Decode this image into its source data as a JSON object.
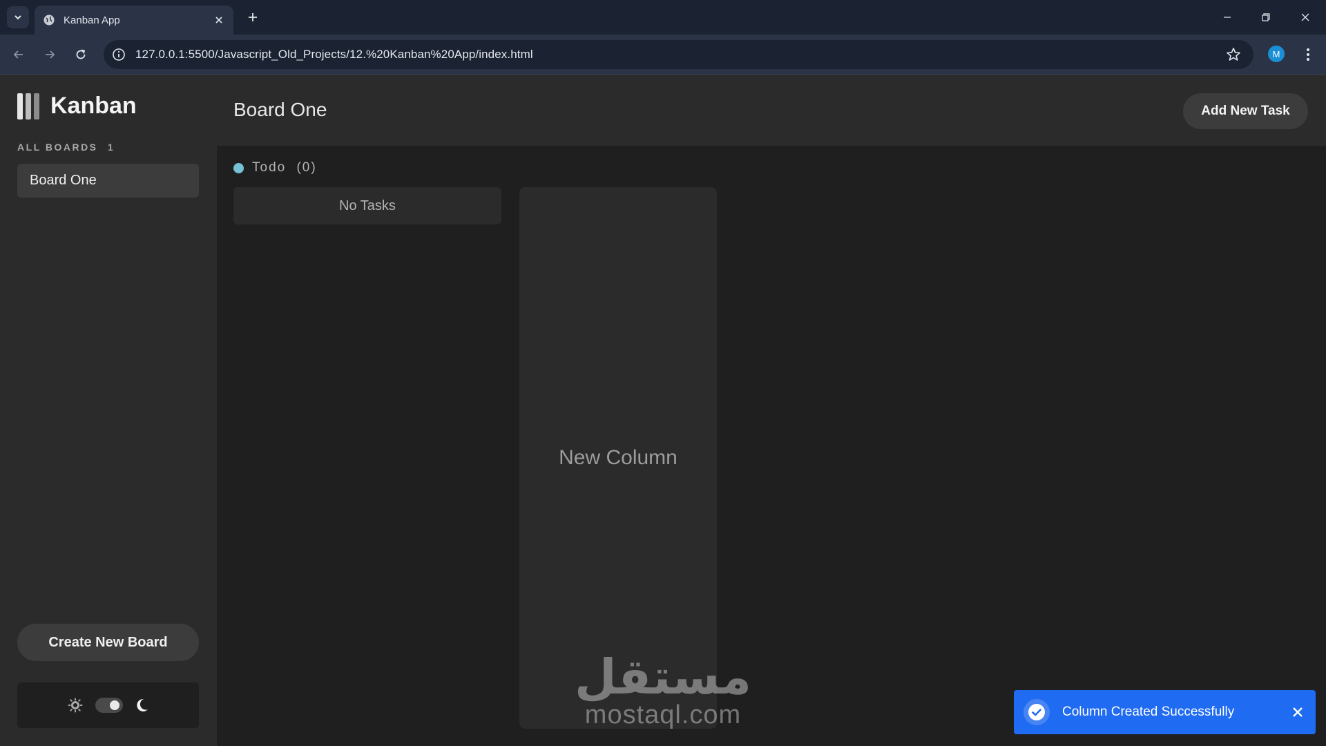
{
  "browser": {
    "tab_title": "Kanban App",
    "url": "127.0.0.1:5500/Javascript_Old_Projects/12.%20Kanban%20App/index.html",
    "profile_initial": "M",
    "icons": [
      "chevron-down-icon",
      "globe-icon",
      "close-icon",
      "plus-icon",
      "minimize-icon",
      "restore-icon",
      "back-arrow-icon",
      "forward-arrow-icon",
      "reload-icon",
      "site-info-icon",
      "star-icon",
      "kebab-menu-icon"
    ]
  },
  "sidebar": {
    "logo_text": "Kanban",
    "all_boards_label": "ALL BOARDS",
    "board_count": "1",
    "boards": [
      {
        "label": "Board One"
      }
    ],
    "create_board_label": "Create New Board",
    "theme": {
      "mode": "dark",
      "icons": [
        "sun-icon",
        "moon-icon"
      ]
    }
  },
  "header": {
    "board_title": "Board One",
    "add_task_label": "Add New Task"
  },
  "columns": [
    {
      "name": "Todo",
      "count_text": "(0)",
      "dot_color": "#76c1d6",
      "empty_text": "No Tasks"
    }
  ],
  "new_column_label": "New Column",
  "watermark": {
    "arabic": "مستقل",
    "latin": "mostaql.com"
  },
  "toast": {
    "message": "Column Created Successfully",
    "color": "#1f6bf2"
  },
  "colors": {
    "sidebar_bg": "#2b2b2b",
    "board_bg": "#1f1f1f",
    "button_bg": "#3c3c3c",
    "logo_bars": [
      "#e6e6e6",
      "#bdbdbd",
      "#8c8c8c"
    ]
  }
}
